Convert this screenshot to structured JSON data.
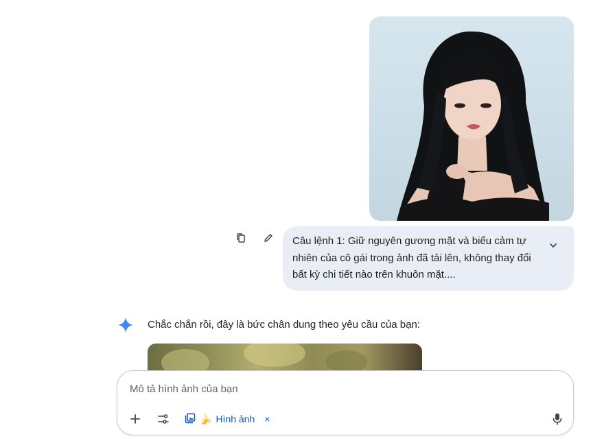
{
  "user_message": {
    "text": "Câu lệnh 1: Giữ nguyên gương mặt và biểu cảm tự nhiên của cô gái trong ảnh đã tải lên, không thay đổi bất kỳ chi tiết nào trên khuôn mặt....",
    "actions": [
      "copy-icon",
      "edit-icon"
    ],
    "expand_icon": "chevron-down-icon"
  },
  "assistant": {
    "icon": "gemini-sparkle-icon",
    "reply_text": "Chắc chắn rồi, đây là bức chân dung theo yêu cầu của bạn:"
  },
  "composer": {
    "placeholder": "Mô tả hình ảnh của bạn",
    "tools": [
      "add-icon",
      "tools-icon"
    ],
    "chip": {
      "emoji": "🍌",
      "label": "Hình ảnh",
      "close": "×"
    },
    "mic_icon": "mic-icon"
  },
  "colors": {
    "accent": "#0b57d0",
    "bubble": "#e9eef6",
    "sparkle": "#4285f4"
  }
}
